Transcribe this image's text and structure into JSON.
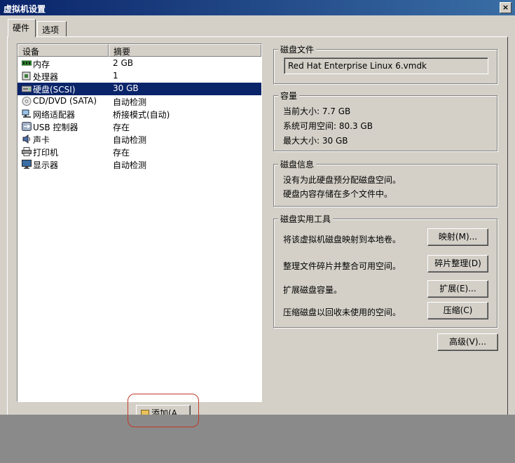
{
  "window": {
    "title": "虚拟机设置",
    "close_glyph": "×"
  },
  "tabs": [
    {
      "label": "硬件"
    },
    {
      "label": "选项"
    }
  ],
  "device_list": {
    "headers": {
      "device": "设备",
      "summary": "摘要"
    },
    "rows": [
      {
        "name": "内存",
        "summary": "2 GB",
        "icon": "memory-icon"
      },
      {
        "name": "处理器",
        "summary": "1",
        "icon": "processor-icon"
      },
      {
        "name": "硬盘(SCSI)",
        "summary": "30 GB",
        "icon": "hard-disk-icon"
      },
      {
        "name": "CD/DVD (SATA)",
        "summary": "自动检测",
        "icon": "cd-dvd-icon"
      },
      {
        "name": "网络适配器",
        "summary": "桥接模式(自动)",
        "icon": "network-adapter-icon"
      },
      {
        "name": "USB 控制器",
        "summary": "存在",
        "icon": "usb-icon"
      },
      {
        "name": "声卡",
        "summary": "自动检测",
        "icon": "sound-card-icon"
      },
      {
        "name": "打印机",
        "summary": "存在",
        "icon": "printer-icon"
      },
      {
        "name": "显示器",
        "summary": "自动检测",
        "icon": "display-icon"
      }
    ],
    "selected_index": 2
  },
  "disk_file": {
    "legend": "磁盘文件",
    "value": "Red Hat Enterprise Linux 6.vmdk"
  },
  "capacity": {
    "legend": "容量",
    "current_size": "当前大小: 7.7 GB",
    "system_free": "系统可用空间: 80.3 GB",
    "max_size": "最大大小: 30 GB"
  },
  "disk_info": {
    "legend": "磁盘信息",
    "line1": "没有为此硬盘预分配磁盘空间。",
    "line2": "硬盘内容存储在多个文件中。"
  },
  "disk_utilities": {
    "legend": "磁盘实用工具",
    "map_desc": "将该虚拟机磁盘映射到本地卷。",
    "map_button": "映射(M)...",
    "defrag_desc": "整理文件碎片并整合可用空间。",
    "defrag_button": "碎片整理(D)",
    "expand_desc": "扩展磁盘容量。",
    "expand_button": "扩展(E)...",
    "compact_desc": "压缩磁盘以回收未使用的空间。",
    "compact_button": "压缩(C)"
  },
  "advanced_button": "高级(V)...",
  "add_button": "添加(A",
  "colors": {
    "title_bar": "#0a246a",
    "selection": "#0a246a",
    "annotation": "#c0392b",
    "face": "#d4d0c8"
  }
}
